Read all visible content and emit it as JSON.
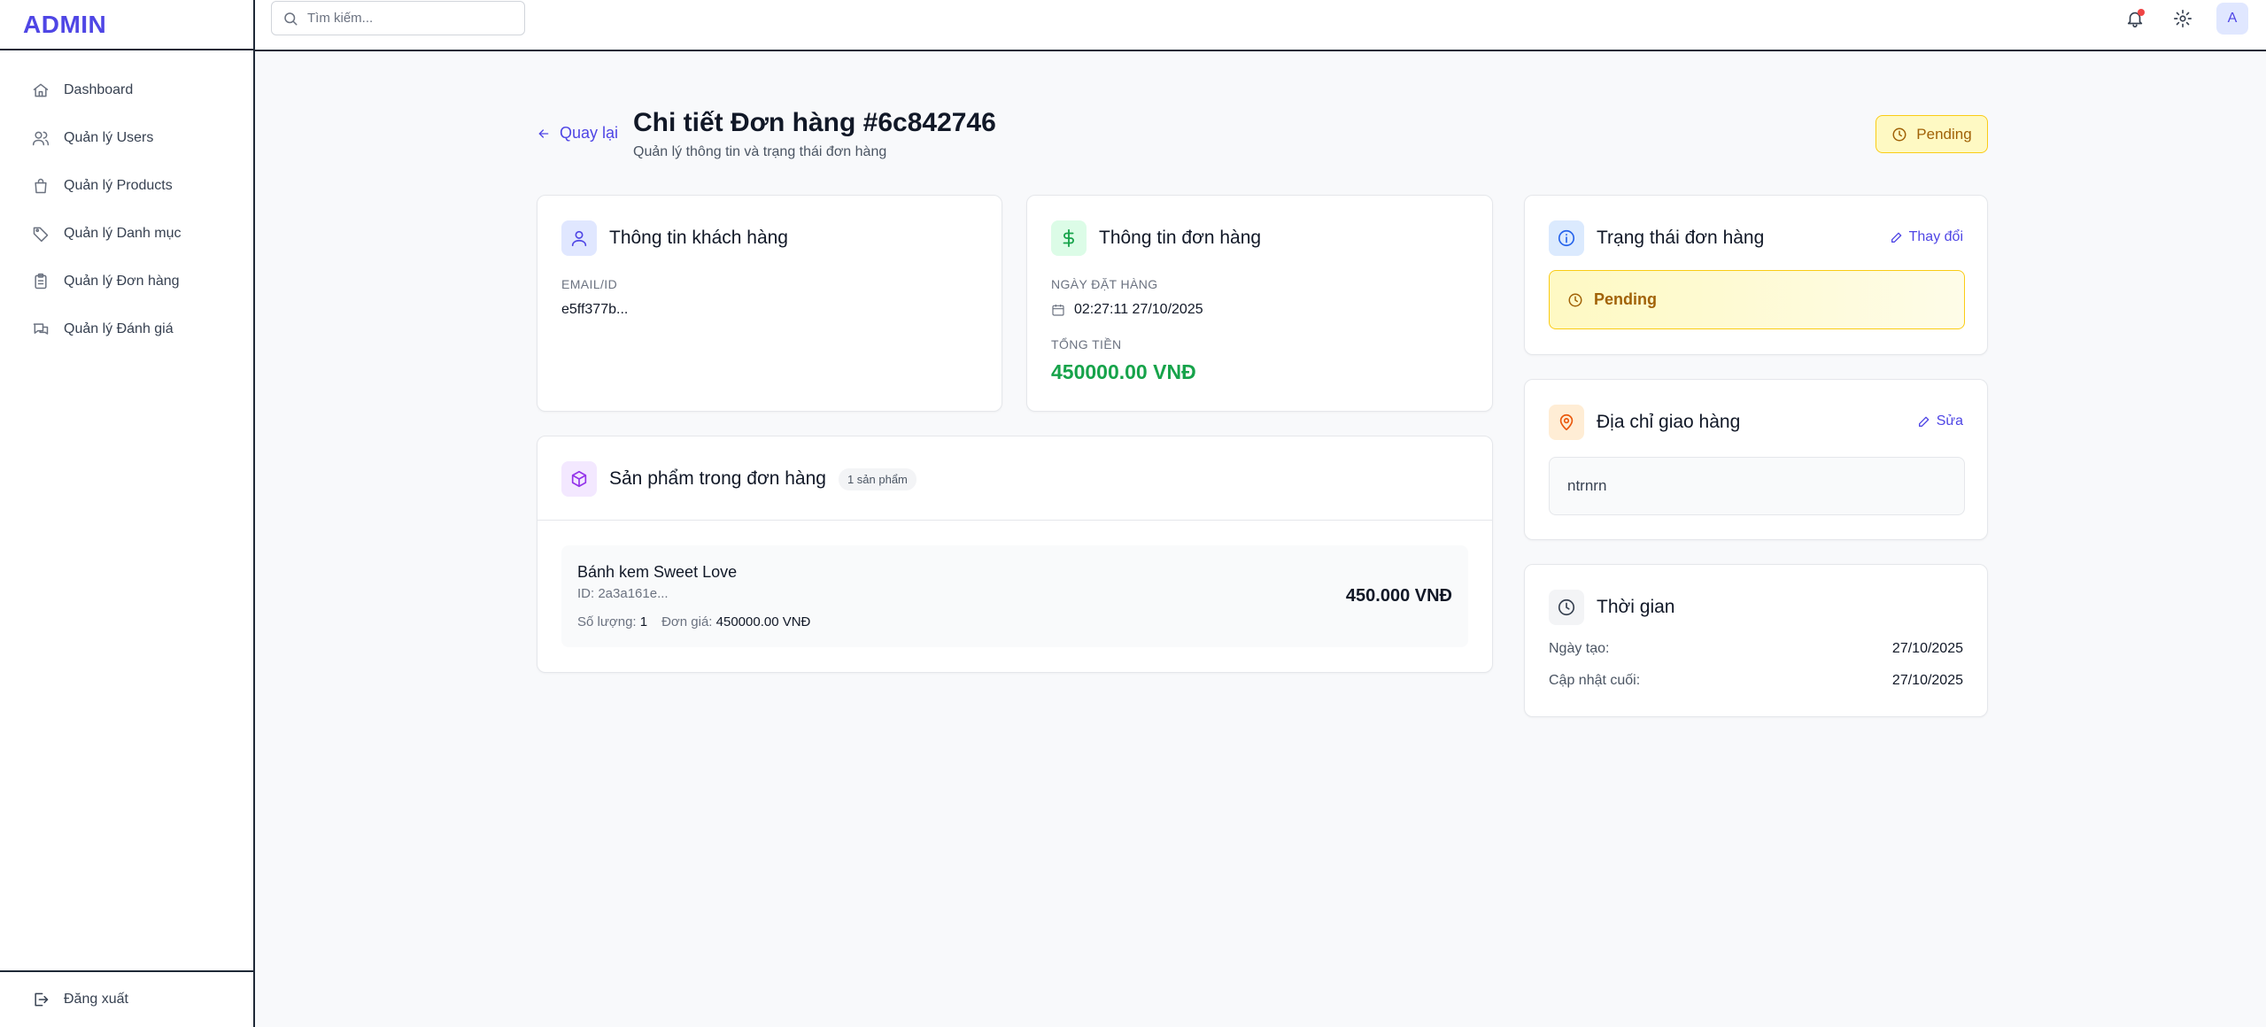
{
  "brand": "ADMIN",
  "sidebar": {
    "items": [
      {
        "label": "Dashboard",
        "icon": "home-icon"
      },
      {
        "label": "Quản lý Users",
        "icon": "users-icon"
      },
      {
        "label": "Quản lý Products",
        "icon": "shopping-bag-icon"
      },
      {
        "label": "Quản lý Danh mục",
        "icon": "tag-icon"
      },
      {
        "label": "Quản lý Đơn hàng",
        "icon": "clipboard-icon"
      },
      {
        "label": "Quản lý Đánh giá",
        "icon": "chat-icon"
      }
    ],
    "logout_label": "Đăng xuất"
  },
  "topbar": {
    "search_placeholder": "Tìm kiếm...",
    "avatar_initial": "A"
  },
  "header": {
    "back_label": "Quay lại",
    "title": "Chi tiết Đơn hàng #6c842746",
    "subtitle": "Quản lý thông tin và trạng thái đơn hàng",
    "status": "Pending"
  },
  "customer": {
    "title": "Thông tin khách hàng",
    "id_label": "EMAIL/ID",
    "id_value": "e5ff377b..."
  },
  "order_info": {
    "title": "Thông tin đơn hàng",
    "date_label": "NGÀY ĐẶT HÀNG",
    "date_value": "02:27:11 27/10/2025",
    "total_label": "TỔNG TIỀN",
    "total_value": "450000.00 VNĐ"
  },
  "products": {
    "title": "Sản phẩm trong đơn hàng",
    "count_badge": "1 sản phẩm",
    "items": [
      {
        "name": "Bánh kem Sweet Love",
        "id": "ID: 2a3a161e...",
        "qty_label": "Số lượng:",
        "qty": "1",
        "price_label": "Đơn giá:",
        "price": "450000.00 VNĐ",
        "subtotal": "450.000 VNĐ"
      }
    ]
  },
  "status_card": {
    "title": "Trạng thái đơn hàng",
    "edit_label": "Thay đổi",
    "status": "Pending"
  },
  "address_card": {
    "title": "Địa chỉ giao hàng",
    "edit_label": "Sửa",
    "address": "ntrnrn"
  },
  "time_card": {
    "title": "Thời gian",
    "created_label": "Ngày tạo:",
    "created_value": "27/10/2025",
    "updated_label": "Cập nhật cuối:",
    "updated_value": "27/10/2025"
  },
  "colors": {
    "accent": "#4f46e5",
    "success": "#16a34a",
    "pending_bg": "#fef9c3",
    "pending_text": "#a16207"
  }
}
